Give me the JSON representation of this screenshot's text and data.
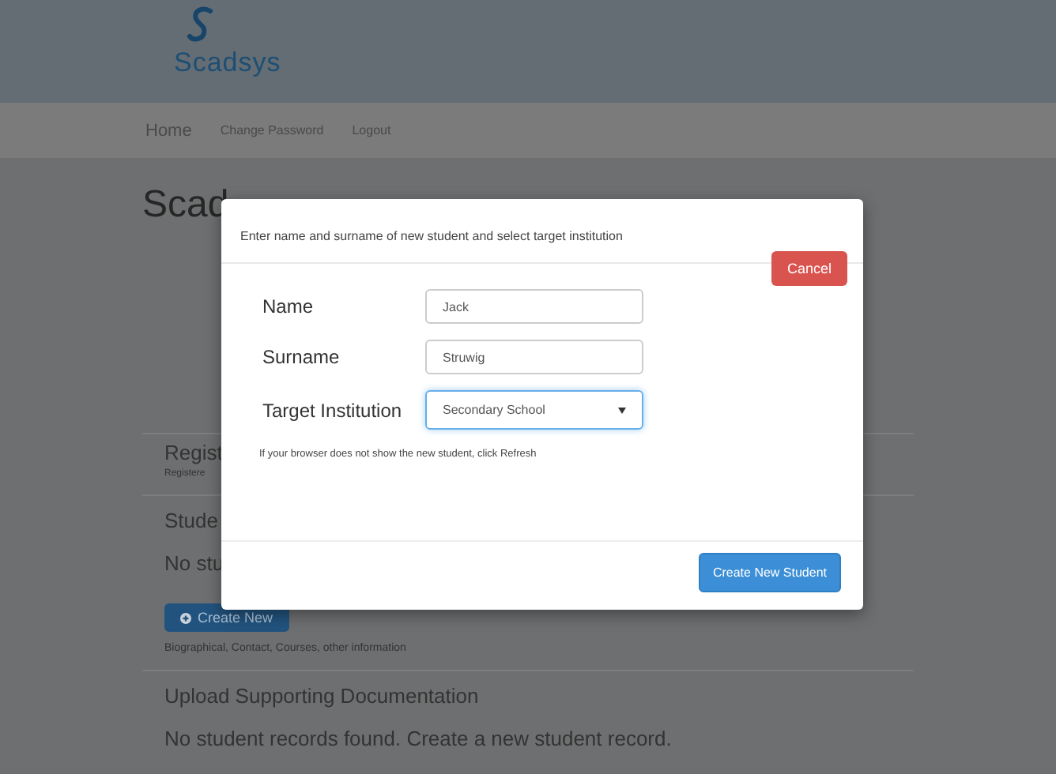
{
  "header": {
    "logo_text": "Scadsys"
  },
  "nav": [
    {
      "label": "Home"
    },
    {
      "label": "Change Password"
    },
    {
      "label": "Logout"
    }
  ],
  "background": {
    "title": "Scad",
    "sections": [
      {
        "heading": "Regist",
        "note": "Registere"
      },
      {
        "heading": "Stude",
        "note": "No stu",
        "button": "Create New",
        "caption": "Biographical, Contact, Courses, other information"
      },
      {
        "heading": "Upload Supporting Documentation",
        "note": "No student records found. Create a new student record."
      }
    ]
  },
  "modal": {
    "title": "Enter name and surname of new student and select target institution",
    "cancel": "Cancel",
    "fields": [
      {
        "label": "Name",
        "kind": "text",
        "value": "Jack",
        "focused": false
      },
      {
        "label": "Surname",
        "kind": "text",
        "value": "Struwig",
        "focused": false
      },
      {
        "label": "Target Institution",
        "kind": "select",
        "value": "Secondary School",
        "focused": true
      }
    ],
    "help": "If your browser does not show the new student, click Refresh",
    "submit": "Create New Student"
  }
}
